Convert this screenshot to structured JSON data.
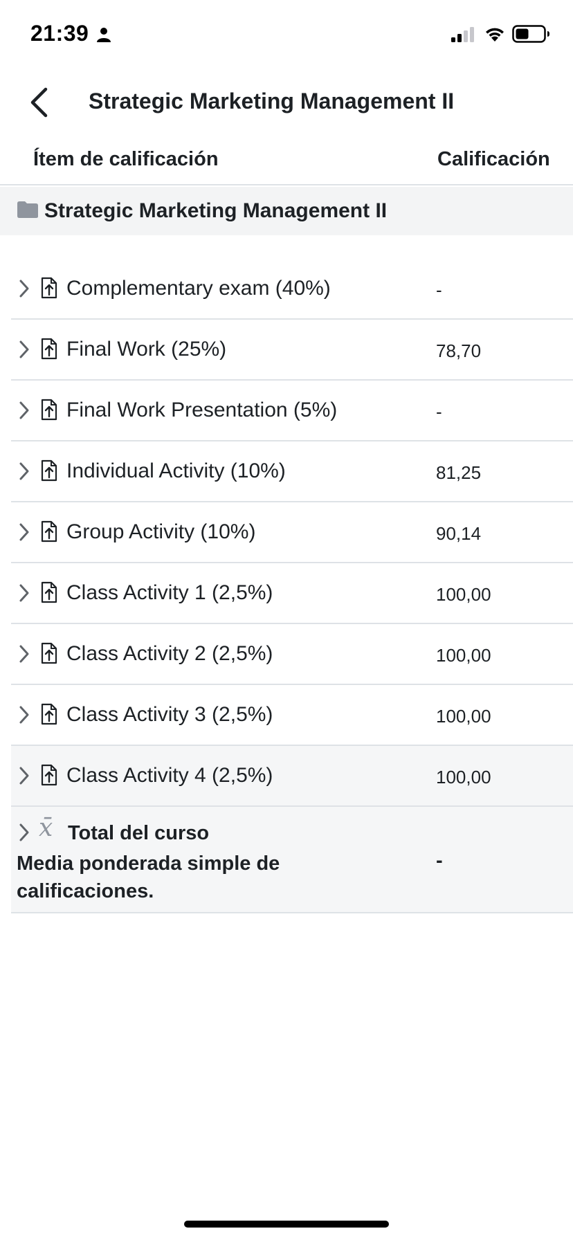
{
  "status_bar": {
    "time": "21:39",
    "icons": [
      "person-icon",
      "signal-icon",
      "wifi-icon",
      "battery-icon"
    ]
  },
  "header": {
    "title": "Strategic Marketing Management II",
    "back_icon": "chevron-left-icon"
  },
  "table": {
    "col_item": "Ítem de calificación",
    "col_grade": "Calificación",
    "category": "Strategic Marketing Management II",
    "category_icon": "folder-icon",
    "items": [
      {
        "name": "Complementary exam (40%)",
        "grade": "-"
      },
      {
        "name": "Final Work (25%)",
        "grade": "78,70"
      },
      {
        "name": "Final Work Presentation (5%)",
        "grade": "-"
      },
      {
        "name": "Individual Activity (10%)",
        "grade": "81,25"
      },
      {
        "name": "Group Activity (10%)",
        "grade": "90,14"
      },
      {
        "name": "Class Activity 1 (2,5%)",
        "grade": "100,00"
      },
      {
        "name": "Class Activity 2 (2,5%)",
        "grade": "100,00"
      },
      {
        "name": "Class Activity 3 (2,5%)",
        "grade": "100,00"
      },
      {
        "name": "Class Activity 4 (2,5%)",
        "grade": "100,00"
      }
    ],
    "total": {
      "symbol": "x̄",
      "title": "Total del curso",
      "description": "Media ponderada simple de calificaciones.",
      "grade": "-"
    }
  },
  "colors": {
    "text": "#1d2125",
    "icon_gray": "#8f959e",
    "row_highlight": "#f5f6f7",
    "divider": "#dee2e6"
  }
}
